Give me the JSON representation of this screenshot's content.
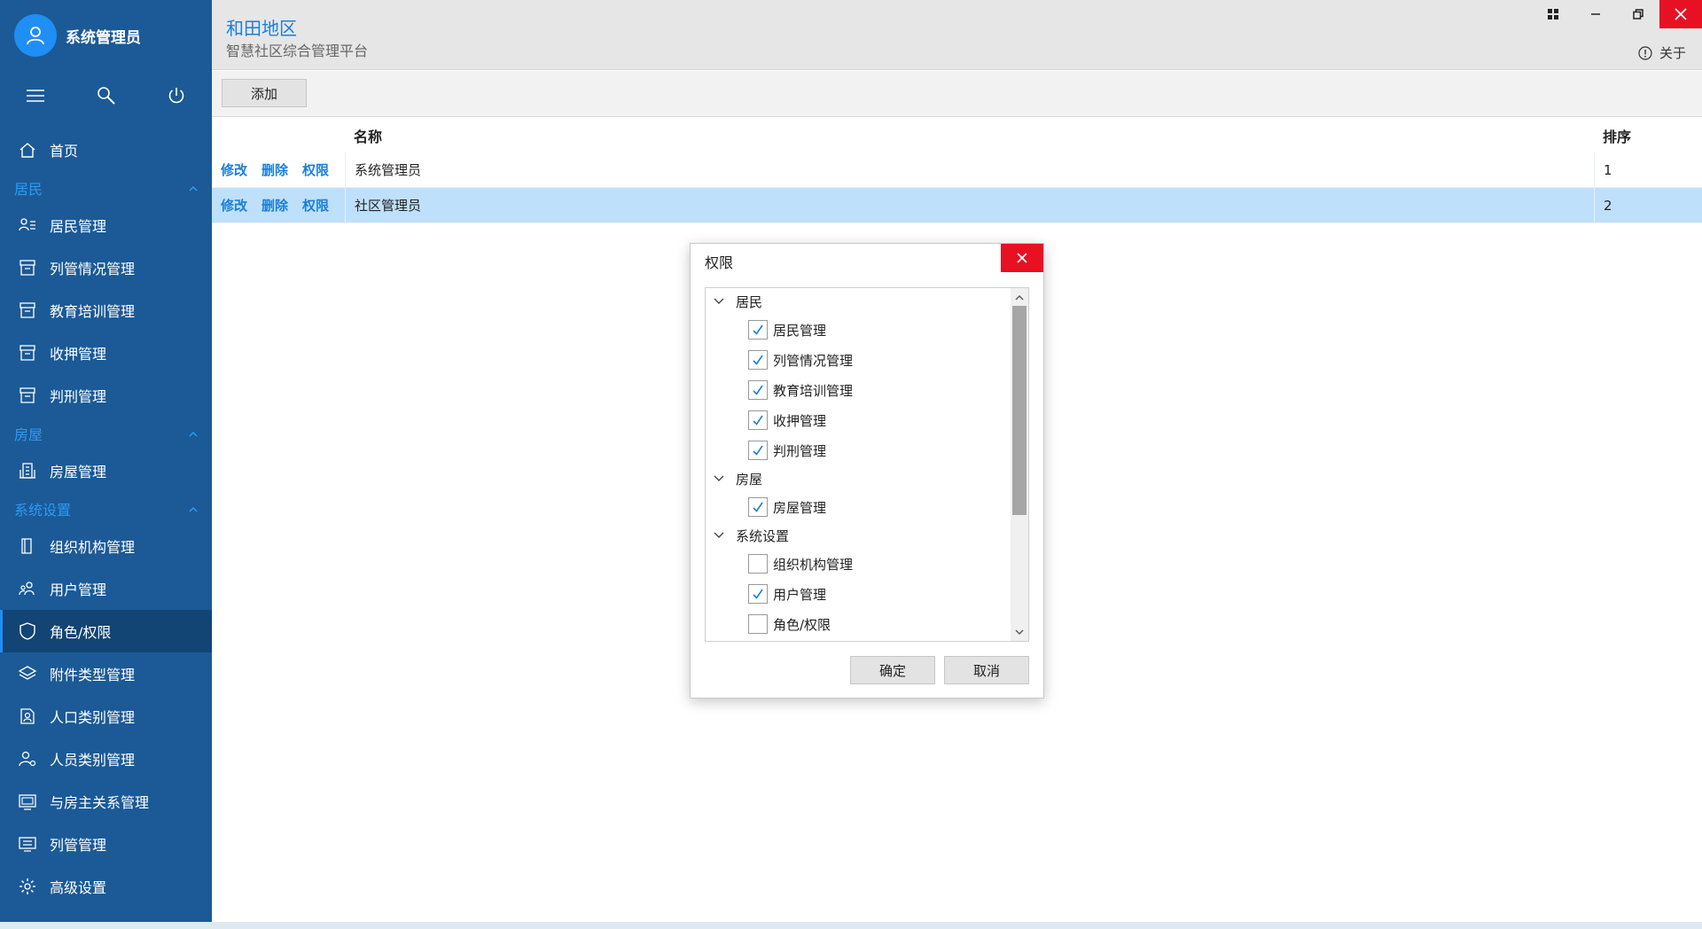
{
  "sidebar": {
    "username": "系统管理员",
    "items": [
      {
        "type": "item",
        "label": "首页",
        "icon": "home-icon"
      },
      {
        "type": "group",
        "label": "居民"
      },
      {
        "type": "item",
        "label": "居民管理",
        "icon": "user-list-icon"
      },
      {
        "type": "item",
        "label": "列管情况管理",
        "icon": "archive-icon"
      },
      {
        "type": "item",
        "label": "教育培训管理",
        "icon": "archive-icon"
      },
      {
        "type": "item",
        "label": "收押管理",
        "icon": "archive-icon"
      },
      {
        "type": "item",
        "label": "判刑管理",
        "icon": "archive-icon"
      },
      {
        "type": "group",
        "label": "房屋"
      },
      {
        "type": "item",
        "label": "房屋管理",
        "icon": "building-icon"
      },
      {
        "type": "group",
        "label": "系统设置"
      },
      {
        "type": "item",
        "label": "组织机构管理",
        "icon": "book-icon"
      },
      {
        "type": "item",
        "label": "用户管理",
        "icon": "users-icon"
      },
      {
        "type": "item",
        "label": "角色/权限",
        "icon": "shield-icon",
        "active": true
      },
      {
        "type": "item",
        "label": "附件类型管理",
        "icon": "layers-icon"
      },
      {
        "type": "item",
        "label": "人口类别管理",
        "icon": "person-category-icon"
      },
      {
        "type": "item",
        "label": "人员类别管理",
        "icon": "person-settings-icon"
      },
      {
        "type": "item",
        "label": "与房主关系管理",
        "icon": "monitor-icon"
      },
      {
        "type": "item",
        "label": "列管管理",
        "icon": "screen-list-icon"
      },
      {
        "type": "item",
        "label": "高级设置",
        "icon": "gear-icon"
      }
    ]
  },
  "header": {
    "title": "和田地区",
    "subtitle": "智慧社区综合管理平台",
    "about": "关于"
  },
  "toolbar": {
    "add_label": "添加"
  },
  "table": {
    "columns": {
      "name": "名称",
      "order": "排序"
    },
    "actions": {
      "edit": "修改",
      "delete": "删除",
      "perm": "权限"
    },
    "rows": [
      {
        "name": "系统管理员",
        "order": "1"
      },
      {
        "name": "社区管理员",
        "order": "2"
      }
    ]
  },
  "dialog": {
    "title": "权限",
    "groups": [
      {
        "label": "居民",
        "children": [
          {
            "label": "居民管理",
            "checked": true
          },
          {
            "label": "列管情况管理",
            "checked": true
          },
          {
            "label": "教育培训管理",
            "checked": true
          },
          {
            "label": "收押管理",
            "checked": true
          },
          {
            "label": "判刑管理",
            "checked": true
          }
        ]
      },
      {
        "label": "房屋",
        "children": [
          {
            "label": "房屋管理",
            "checked": true
          }
        ]
      },
      {
        "label": "系统设置",
        "children": [
          {
            "label": "组织机构管理",
            "checked": false
          },
          {
            "label": "用户管理",
            "checked": true
          },
          {
            "label": "角色/权限",
            "checked": false
          }
        ]
      }
    ],
    "ok": "确定",
    "cancel": "取消"
  },
  "colors": {
    "sidebar_bg": "#1b5a96",
    "accent": "#1c7fd6",
    "selected_row": "#bfe0fb",
    "close_red": "#e81123"
  }
}
